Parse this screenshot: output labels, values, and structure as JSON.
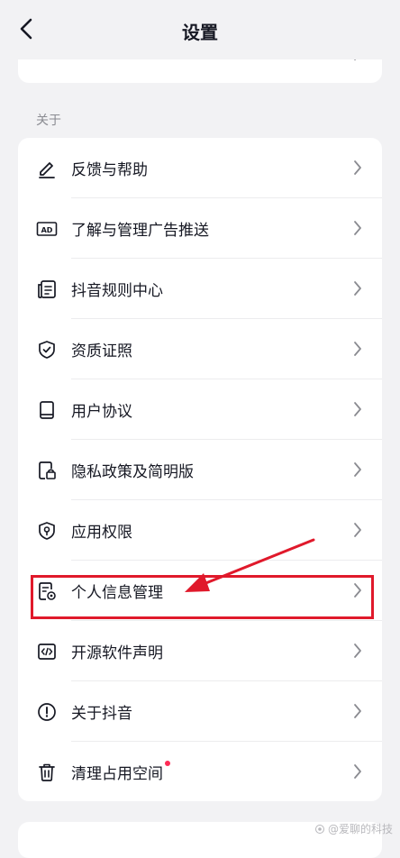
{
  "header": {
    "title": "设置",
    "back_icon": "chevron-left-icon"
  },
  "top_card": {
    "cut_text": "……"
  },
  "about_section": {
    "label": "关于",
    "items": [
      {
        "label": "反馈与帮助",
        "icon": "pencil-icon"
      },
      {
        "label": "了解与管理广告推送",
        "icon": "ad-icon"
      },
      {
        "label": "抖音规则中心",
        "icon": "rules-document-icon"
      },
      {
        "label": "资质证照",
        "icon": "shield-check-icon"
      },
      {
        "label": "用户协议",
        "icon": "book-icon"
      },
      {
        "label": "隐私政策及简明版",
        "icon": "privacy-lock-document-icon"
      },
      {
        "label": "应用权限",
        "icon": "permission-shield-icon"
      },
      {
        "label": "个人信息管理",
        "icon": "personal-info-document-icon"
      },
      {
        "label": "开源软件声明",
        "icon": "code-icon"
      },
      {
        "label": "关于抖音",
        "icon": "info-circle-icon"
      },
      {
        "label": "清理占用空间",
        "icon": "trash-icon",
        "badge": true
      }
    ]
  },
  "annotation": {
    "highlight_color": "#e0192b"
  },
  "watermark": {
    "text": "@爱聊的科技"
  },
  "colors": {
    "background": "#f2f2f4",
    "card": "#ffffff",
    "text": "#161823",
    "secondary_text": "#8a8b91",
    "badge": "#fe2c55"
  }
}
